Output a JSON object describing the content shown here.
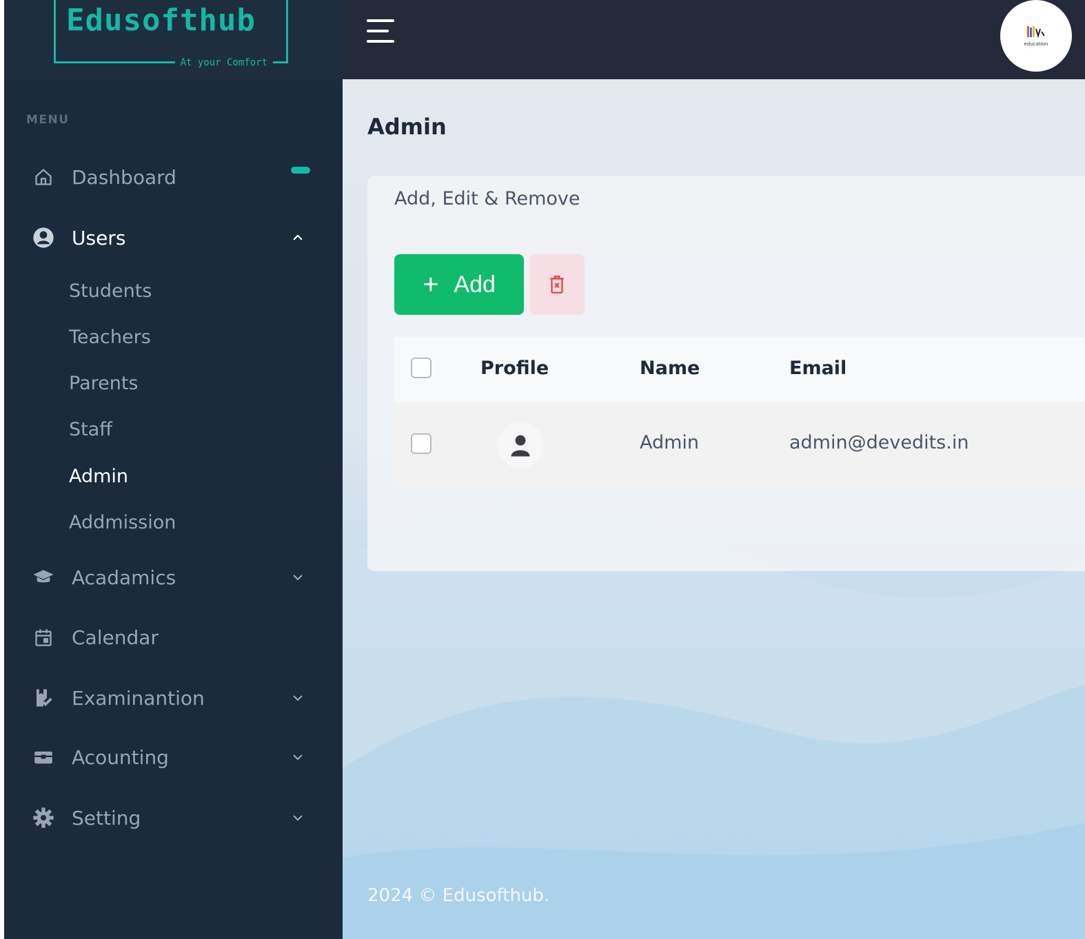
{
  "brand": {
    "name": "Edusofthub",
    "tagline": "At your Comfort"
  },
  "sidebar": {
    "menu_label": "MENU",
    "items": [
      {
        "label": "Dashboard",
        "icon": "home-icon",
        "indicator": true
      },
      {
        "label": "Users",
        "icon": "user-circle-icon",
        "expanded": true,
        "children": [
          "Students",
          "Teachers",
          "Parents",
          "Staff",
          "Admin",
          "Addmission"
        ],
        "current": "Admin"
      },
      {
        "label": "Acadamics",
        "icon": "graduation-cap-icon",
        "expandable": true
      },
      {
        "label": "Calendar",
        "icon": "calendar-icon"
      },
      {
        "label": "Examinantion",
        "icon": "exam-icon",
        "expandable": true
      },
      {
        "label": "Acounting",
        "icon": "wallet-icon",
        "expandable": true
      },
      {
        "label": "Setting",
        "icon": "gear-icon",
        "expandable": true
      }
    ]
  },
  "topbar": {
    "menu_icon": "hamburger-icon",
    "avatar_caption": "education"
  },
  "page": {
    "title": "Admin",
    "card_subtitle": "Add, Edit & Remove",
    "add_button": {
      "icon": "plus",
      "label": "Add"
    },
    "delete_icon": "trash-icon",
    "table": {
      "columns": [
        "Profile",
        "Name",
        "Email"
      ],
      "rows": [
        {
          "profile": "person-icon",
          "name": "Admin",
          "email": "admin@devedits.in"
        }
      ]
    }
  },
  "footer": {
    "text": "2024 © Edusofthub."
  },
  "colors": {
    "sidebar": "#1c2a3e",
    "accent": "#14b8a6",
    "add_button": "#10bc6c",
    "delete_bg": "#f6dfe4",
    "delete_icon": "#e5484d"
  }
}
